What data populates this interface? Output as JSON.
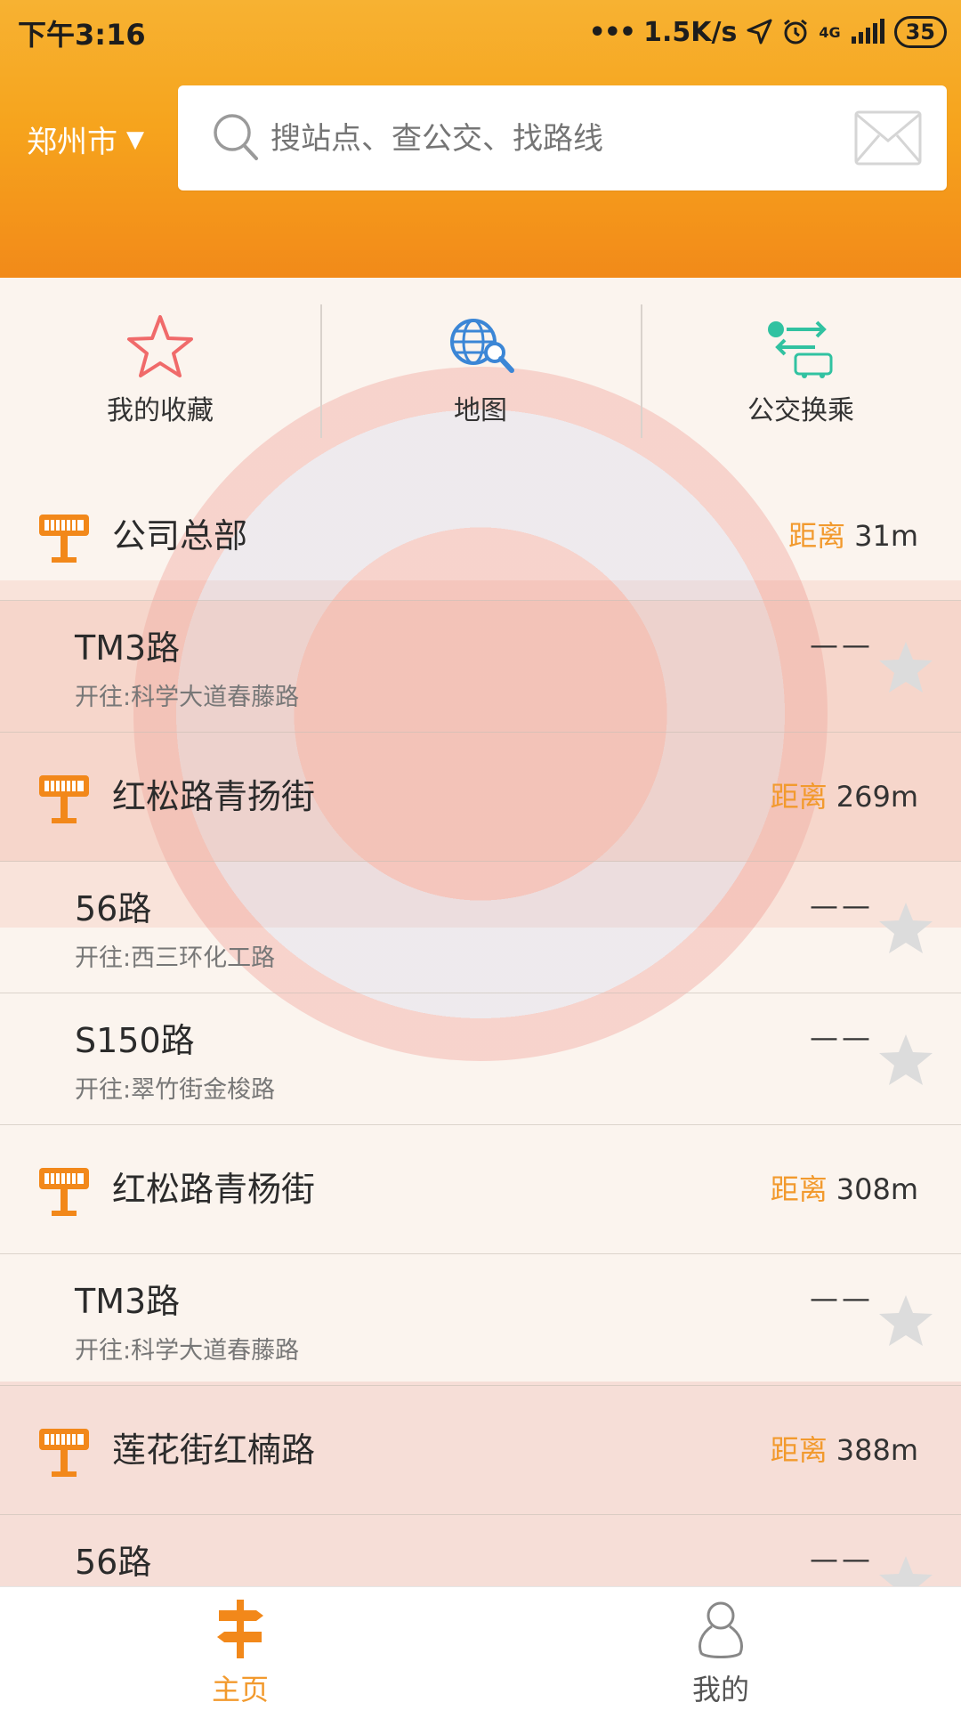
{
  "status_bar": {
    "time": "下午3:16",
    "network_speed": "1.5K/s",
    "network_type": "4G",
    "battery": "35"
  },
  "header": {
    "city": "郑州市",
    "search_placeholder": "搜站点、查公交、找路线"
  },
  "quick_actions": [
    {
      "label": "我的收藏",
      "icon": "star-icon"
    },
    {
      "label": "地图",
      "icon": "globe-search-icon"
    },
    {
      "label": "公交换乘",
      "icon": "bus-transfer-icon"
    }
  ],
  "list": {
    "distance_label": "距离",
    "destination_prefix": "开往:",
    "stops": [
      {
        "name": "公司总部",
        "distance": "31m",
        "routes": [
          {
            "name": "TM3路",
            "destination": "科学大道春藤路",
            "arrival": "——"
          }
        ]
      },
      {
        "name": "红松路青扬街",
        "distance": "269m",
        "routes": [
          {
            "name": "56路",
            "destination": "西三环化工路",
            "arrival": "——"
          },
          {
            "name": "S150路",
            "destination": "翠竹街金梭路",
            "arrival": "——"
          }
        ]
      },
      {
        "name": "红松路青杨街",
        "distance": "308m",
        "routes": [
          {
            "name": "TM3路",
            "destination": "科学大道春藤路",
            "arrival": "——"
          }
        ]
      },
      {
        "name": "莲花街红楠路",
        "distance": "388m",
        "routes": [
          {
            "name": "56路",
            "destination": "",
            "arrival": "——"
          }
        ]
      }
    ]
  },
  "bottom_nav": {
    "home": "主页",
    "mine": "我的"
  },
  "colors": {
    "brand_orange": "#f6a41d",
    "accent_text": "#f29a2e"
  }
}
